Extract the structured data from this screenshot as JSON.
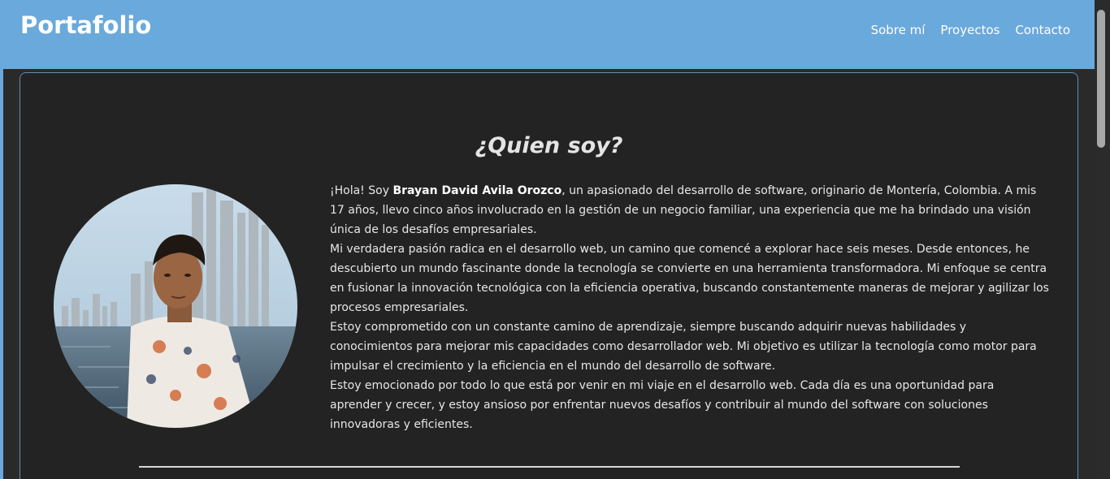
{
  "header": {
    "brand": "Portafolio",
    "nav": {
      "about": "Sobre mí",
      "projects": "Proyectos",
      "contact": "Contacto"
    }
  },
  "about": {
    "title": "¿Quien soy?",
    "avatar_alt": "Foto de perfil",
    "bio": {
      "p1_prefix": "¡Hola! Soy ",
      "p1_name": "Brayan David Avila Orozco",
      "p1_suffix": ", un apasionado del desarrollo de software, originario de Montería, Colombia. A mis 17 años, llevo cinco años involucrado en la gestión de un negocio familiar, una experiencia que me ha brindado una visión única de los desafíos empresariales.",
      "p2": "Mi verdadera pasión radica en el desarrollo web, un camino que comencé a explorar hace seis meses. Desde entonces, he descubierto un mundo fascinante donde la tecnología se convierte en una herramienta transformadora. Mi enfoque se centra en fusionar la innovación tecnológica con la eficiencia operativa, buscando constantemente maneras de mejorar y agilizar los procesos empresariales.",
      "p3": "Estoy comprometido con un constante camino de aprendizaje, siempre buscando adquirir nuevas habilidades y conocimientos para mejorar mis capacidades como desarrollador web. Mi objetivo es utilizar la tecnología como motor para impulsar el crecimiento y la eficiencia en el mundo del desarrollo de software.",
      "p4": "Estoy emocionado por todo lo que está por venir en mi viaje en el desarrollo web. Cada día es una oportunidad para aprender y crecer, y estoy ansioso por enfrentar nuevos desafíos y contribuir al mundo del software con soluciones innovadoras y eficientes."
    }
  },
  "colors": {
    "header_bg": "#6aa9dc",
    "card_bg": "#232323",
    "card_border": "#5e8fb8",
    "text": "#e6e6e6"
  }
}
